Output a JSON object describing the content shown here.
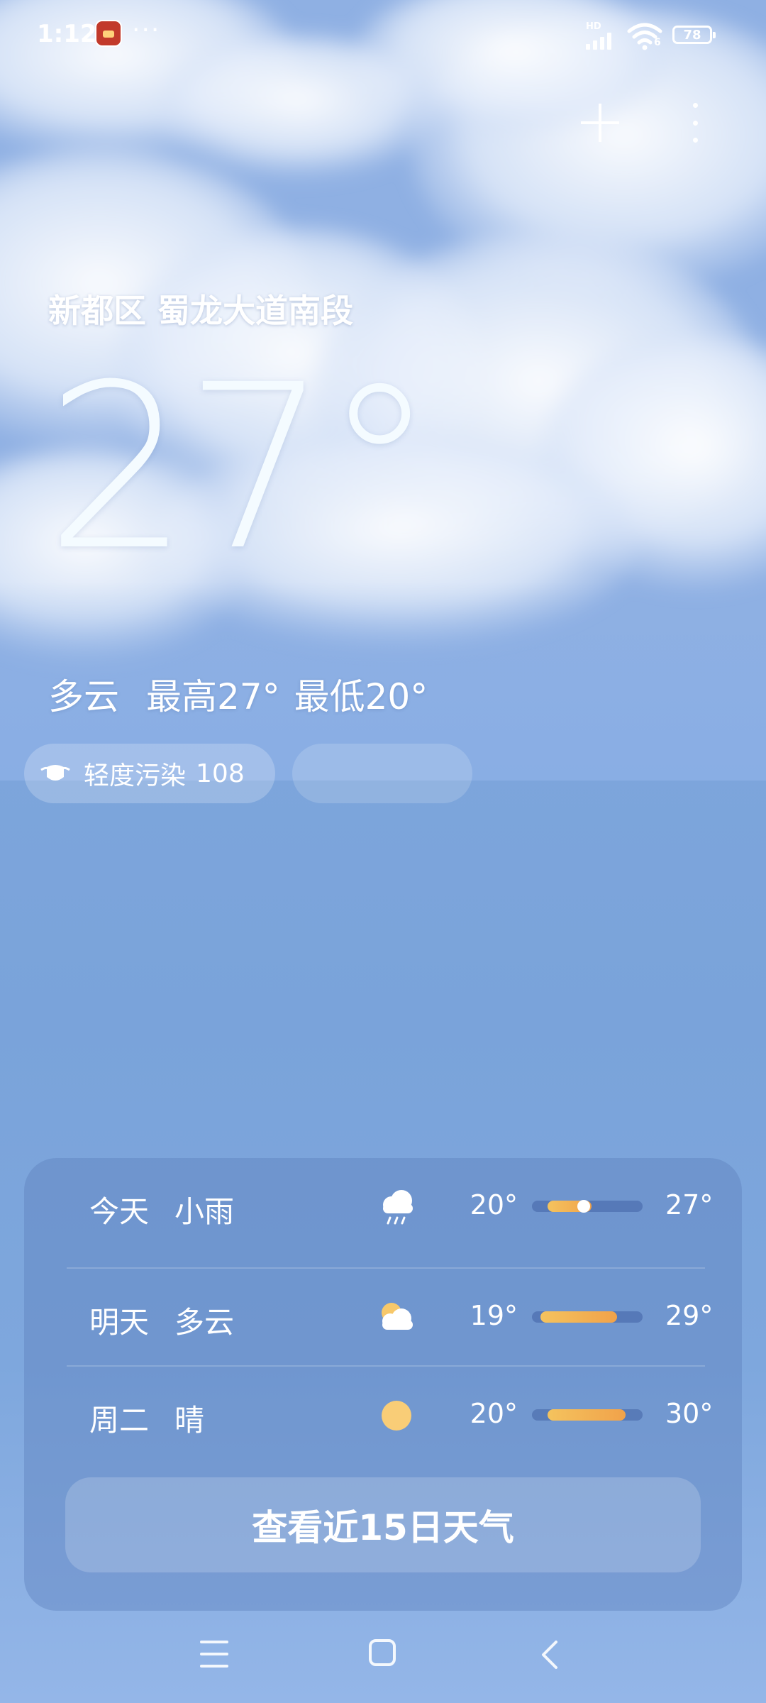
{
  "status_bar": {
    "time": "1:12",
    "more_notifications": "···",
    "network_label": "HD",
    "wifi_number": "6",
    "battery": "78"
  },
  "header": {
    "location": "新都区 蜀龙大道南段"
  },
  "current": {
    "temperature": "27°",
    "condition": "多云",
    "high": "最高27°",
    "low": "最低20°"
  },
  "air_quality": {
    "label": "轻度污染",
    "value": "108"
  },
  "forecast": {
    "rows": [
      {
        "day": "今天",
        "condition": "小雨",
        "icon": "rain-icon",
        "low": "20°",
        "high": "27°"
      },
      {
        "day": "明天",
        "condition": "多云",
        "icon": "partly-cloudy-icon",
        "low": "19°",
        "high": "29°"
      },
      {
        "day": "周二",
        "condition": "晴",
        "icon": "sun-icon",
        "low": "20°",
        "high": "30°"
      }
    ],
    "more_button": "查看近15日天气"
  },
  "colors": {
    "accent_bar": "#f4c35e",
    "sky_top": "#8fb2e6",
    "sky_bottom": "#94b6e8"
  }
}
